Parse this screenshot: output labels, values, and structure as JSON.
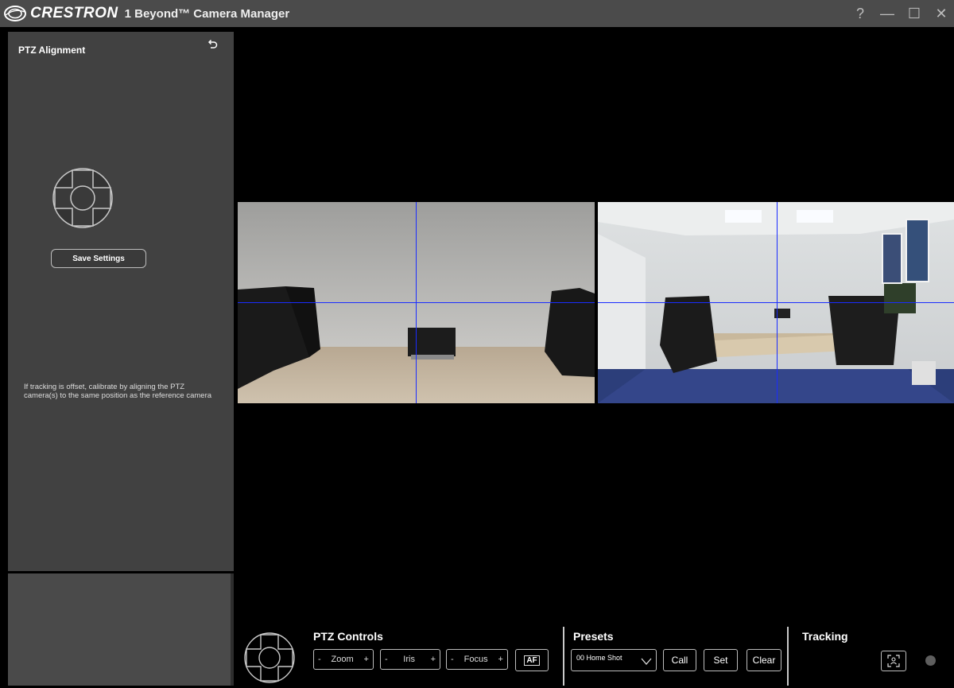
{
  "titlebar": {
    "brand": "CRESTRON",
    "app_title": "1 Beyond™ Camera Manager",
    "help_label": "?",
    "minimize_label": "—",
    "maximize_label": "☐",
    "close_label": "✕"
  },
  "sidebar": {
    "title": "PTZ Alignment",
    "undo_icon": "undo-icon",
    "save_label": "Save Settings",
    "hint": "If tracking is offset, calibrate by aligning the PTZ camera(s) to the same position as the reference camera"
  },
  "views": {
    "left_camera": "ptz-camera-view",
    "right_camera": "reference-camera-view",
    "crosshair_color": "#1a2cff"
  },
  "bottom": {
    "ptz_title": "PTZ Controls",
    "zoom": {
      "minus": "-",
      "label": "Zoom",
      "plus": "+"
    },
    "iris": {
      "minus": "-",
      "label": "Iris",
      "plus": "+"
    },
    "focus": {
      "minus": "-",
      "label": "Focus",
      "plus": "+"
    },
    "af_label": "AF",
    "presets_title": "Presets",
    "preset_selected": "00 Home Shot",
    "call_label": "Call",
    "set_label": "Set",
    "clear_label": "Clear",
    "tracking_title": "Tracking"
  }
}
